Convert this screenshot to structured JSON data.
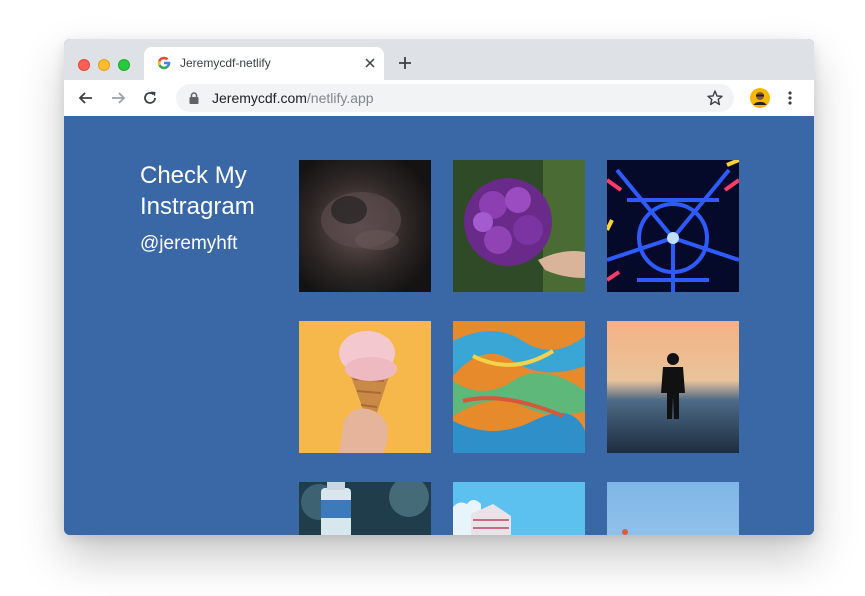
{
  "browser": {
    "tab": {
      "title": "Jeremycdf-netlify"
    },
    "address_bar": {
      "host": "Jeremycdf.com",
      "path": "/netlify.app"
    }
  },
  "page": {
    "heading": "Check My Instragram",
    "handle": "@jeremyhft",
    "background_color": "#3a67a6",
    "gallery": [
      {
        "icon": "dark-cloud-photo"
      },
      {
        "icon": "purple-hydrangea-photo"
      },
      {
        "icon": "blue-neon-structure-photo"
      },
      {
        "icon": "ice-cream-cone-photo"
      },
      {
        "icon": "colorful-fluid-art-photo"
      },
      {
        "icon": "silhouette-sunset-photo"
      },
      {
        "icon": "bottle-photo"
      },
      {
        "icon": "building-sky-photo"
      },
      {
        "icon": "blue-sky-photo"
      }
    ]
  }
}
